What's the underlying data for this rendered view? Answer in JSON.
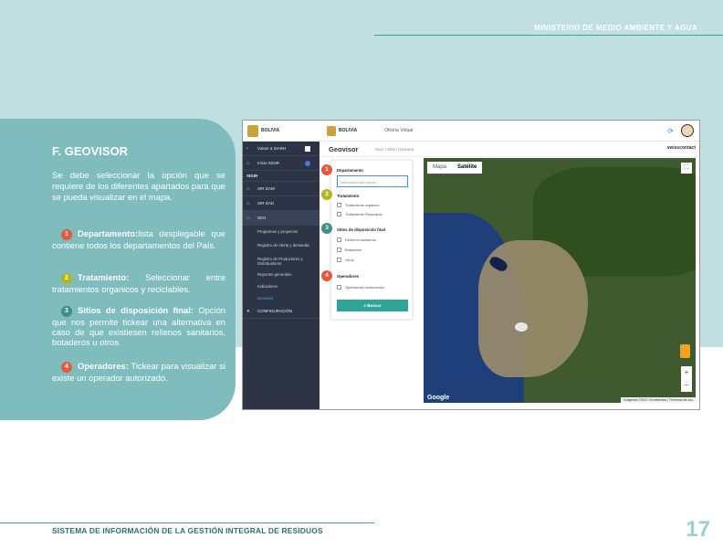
{
  "header": {
    "ministry": "MINISTERIO DE MEDIO AMBIENTE Y AGUA"
  },
  "section": {
    "title": "F. GEOVISOR",
    "intro": "Se debe seleccionar la opción que se requiere de los diferentes apartados para que se pueda visualizar  en el mapa.",
    "items": [
      {
        "num": "1",
        "label": "Departamento:",
        "text": "lista desplegable que contiene todos los departamentos del País."
      },
      {
        "num": "2",
        "label": "Tratamiento:",
        "text": " Seleccionar entre tratamientos organicos y reciclables."
      },
      {
        "num": "3",
        "label": "Sitios de disposición final:",
        "text": " Opción que nos permite tickear una alternativa en caso de que existiesen rellenos sanitarios, botaderos u otros."
      },
      {
        "num": "4",
        "label": "Operadores:",
        "text": " Tickear para visualizar si existe un operador autorizado."
      }
    ]
  },
  "footer": {
    "system": "SISTEMA DE  INFORMACIÓN DE LA GESTIÓN INTEGRAL DE RESIDUOS",
    "page": "17"
  },
  "screenshot": {
    "brand": "BOLIVIA",
    "virtual_office": "Oficina Virtual",
    "sidebar": {
      "back": "Volver a SIARH",
      "home": "Inicio SIGIR",
      "section": "SIGIR",
      "items": [
        "SIR DAM",
        "SIR DAD",
        "SIGI"
      ],
      "subitems": [
        "Programas y proyectos",
        "Registro de oferta y demanda",
        "Registro de Productores y Distribuidores",
        "Reportes generales",
        "Indicadores",
        "Geovisor"
      ],
      "config": "CONFIGURACIÓN"
    },
    "page_title": "Geovisor",
    "breadcrumb": "Inicio  /  SIGI  /  Geovisor",
    "partner": "swisscontact",
    "form": {
      "departamento": "Departamento",
      "departamento_placeholder": "Seleccione una opción",
      "tratamiento": "Tratamiento",
      "tratamiento_options": [
        "Tratamiento orgánico",
        "Tratamiento Reciclable"
      ],
      "sitios": "Sitios de disposición final",
      "sitios_options": [
        "Rellenos sanitarios",
        "Botaderos",
        "Otros"
      ],
      "operadores": "Operadores",
      "operadores_options": [
        "Operadores autorizados"
      ],
      "search_button": "Buscar"
    },
    "map": {
      "tab_map": "Mapa",
      "tab_satellite": "Satélite",
      "logo": "Google",
      "attribution": "Imágenes ©2021 TerraMetrics | Términos de uso"
    }
  }
}
